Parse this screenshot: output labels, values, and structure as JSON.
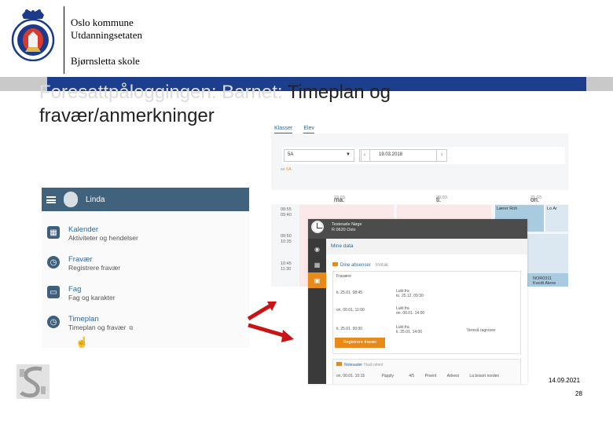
{
  "header": {
    "org_line1": "Oslo kommune",
    "org_line2": "Utdanningsetaten",
    "school": "Bjørnsletta skole"
  },
  "slide": {
    "title_muted": "Foresattpåloggingen: Barnet: ",
    "title_main": "Timeplan og fravær/anmerkninger",
    "date": "14.09.2021",
    "page_number": "28"
  },
  "colors": {
    "blue_bar": "#1d3e8c",
    "menu_header": "#41627d",
    "accent_orange": "#e88a1a",
    "arrow_red": "#c81414"
  },
  "mobile_menu": {
    "user": "Linda",
    "items": [
      {
        "icon": "calendar-icon",
        "title": "Kalender",
        "subtitle": "Aktiviteter og hendelser"
      },
      {
        "icon": "clock-icon",
        "title": "Fravær",
        "subtitle": "Registrere fravær"
      },
      {
        "icon": "book-icon",
        "title": "Fag",
        "subtitle": "Fag og karakter"
      },
      {
        "icon": "clock-icon",
        "title": "Timeplan",
        "subtitle": "Timeplan og fravær"
      }
    ]
  },
  "timetable": {
    "tabs": [
      "Klasser",
      "Elev"
    ],
    "class_select": "5A",
    "date": "19.03.2018",
    "group_prefix": "ss",
    "group": "5A",
    "days": [
      {
        "name": "ma.",
        "date": "19.03."
      },
      {
        "name": "ti.",
        "date": "20.03."
      },
      {
        "name": "on.",
        "date": "21.03."
      }
    ],
    "times": [
      "08:55",
      "09:40",
      "09:50",
      "10:35",
      "10:45",
      "11:30"
    ],
    "lessons": [
      {
        "line1": "Lærer Roh",
        "line2": ""
      },
      {
        "line1": "Lo Ar",
        "line2": ""
      },
      {
        "line1": "NOR0311",
        "line2": "Kvedt Alene"
      }
    ]
  },
  "absence": {
    "student": "Testesøle Nøge",
    "location": "R 0620 Oslo",
    "section": "Mine data",
    "tab_active": "Dine absenser",
    "tab_other": "Inntak",
    "list_header": "Fravære",
    "rows": [
      {
        "from": "ti. 25.01. 08:45",
        "to_prefix": "Lukt.fra",
        "to": "to. 25.12. 09:30",
        "note": ""
      },
      {
        "from": "on. 00.01. 11:00",
        "to_prefix": "Lukt.fra",
        "to": "on. 00.01. 14:00",
        "note": ""
      },
      {
        "from": "ti. 25.01. 00:00",
        "to_prefix": "Lukt.fra",
        "to": "ti. 25.01. 14:00",
        "note": "Vereså ragnover"
      }
    ],
    "register_button": "Registrere fravær",
    "remarks_tab": "Notesader",
    "remarks_other": "Ytadi nitent",
    "remark_row": {
      "date": "on. 00.01. 10:15",
      "who": "Papply",
      "grade": "4/5",
      "type": "Proent",
      "kind": "Advest",
      "note": "La bosort norden"
    }
  }
}
